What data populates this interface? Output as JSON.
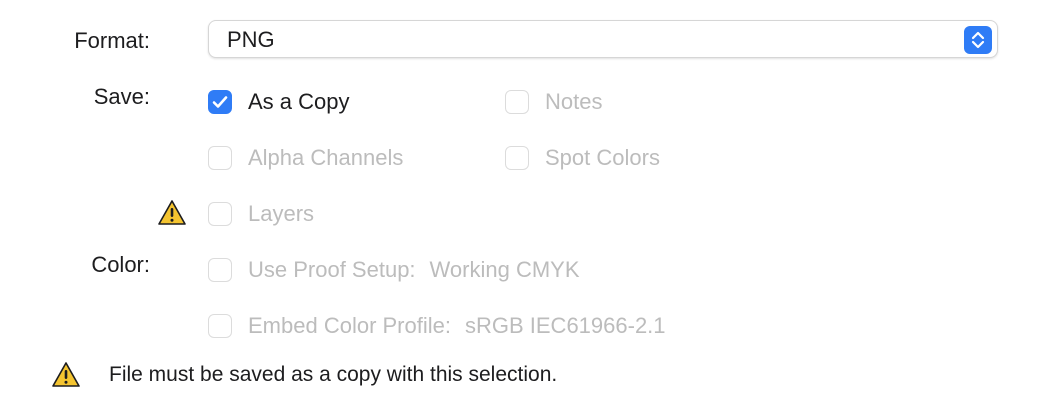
{
  "format": {
    "label": "Format:",
    "value": "PNG"
  },
  "save": {
    "label": "Save:",
    "options": [
      {
        "label": "As a Copy",
        "checked": true,
        "enabled": true
      },
      {
        "label": "Notes",
        "checked": false,
        "enabled": false
      },
      {
        "label": "Alpha Channels",
        "checked": false,
        "enabled": false
      },
      {
        "label": "Spot Colors",
        "checked": false,
        "enabled": false
      },
      {
        "label": "Layers",
        "checked": false,
        "enabled": false
      }
    ]
  },
  "color": {
    "label": "Color:",
    "proof_label": "Use Proof Setup:",
    "proof_value": "Working CMYK",
    "profile_label": "Embed Color Profile:",
    "profile_value": "sRGB IEC61966-2.1"
  },
  "warning": {
    "message": "File must be saved as a copy with this selection."
  },
  "colors": {
    "accent": "#2f7cf6",
    "warning": "#f4c430"
  },
  "icons": {
    "select": "up-down-chevron-icon",
    "warning": "warning-triangle-icon",
    "check": "checkmark-icon"
  }
}
